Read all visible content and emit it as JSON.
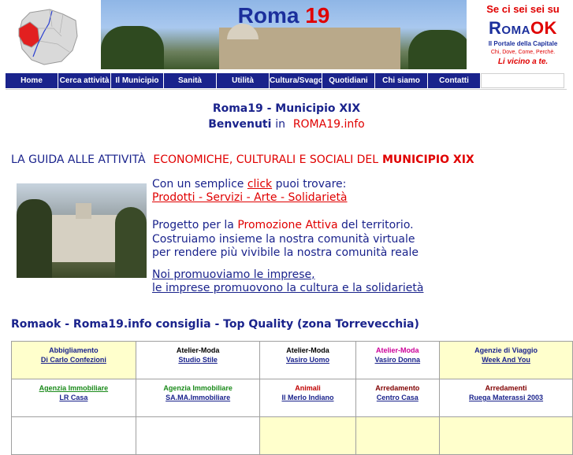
{
  "banner": {
    "title_main": "Roma",
    "title_num": "19"
  },
  "ad": {
    "line1": "Se ci sei sei su",
    "brand_roma": "Roma",
    "brand_ok": "OK",
    "line3": "Il Portale della Capitale",
    "line4": "Chi, Dove, Come, Perchè.",
    "line5": "Li vicino a te."
  },
  "nav": {
    "items": [
      "Home",
      "Cerca attività",
      "Il Municipio",
      "Sanità",
      "Utilità",
      "Cultura/Svago",
      "Quotidiani",
      "Chi siamo",
      "Contatti"
    ]
  },
  "intro": {
    "title": "Roma19 - Municipio XIX",
    "welcome": "Benvenuti",
    "in": "in",
    "site": "ROMA19.info"
  },
  "guide": {
    "part1": "LA GUIDA ALLE ATTIVITÀ",
    "part2": "ECONOMICHE, CULTURALI E SOCIALI DEL",
    "part3": "MUNICIPIO XIX"
  },
  "body": {
    "line1_a": "Con un semplice",
    "line1_link": "click",
    "line1_b": "puoi trovare:",
    "line2_link": "Prodotti - Servizi - Arte - Solidarietà",
    "line3_a": "Progetto per la",
    "line3_red": "Promozione Attiva",
    "line3_b": "del  territorio.",
    "line4": "Costruiamo insieme la nostra comunità virtuale",
    "line5": "per rendere più vivibile la nostra comunità reale",
    "line6_link": "Noi promuoviamo le imprese, ",
    "line7_link": "le imprese promuovono la cultura e la solidarietà"
  },
  "consiglia": {
    "title": "Romaok - Roma19.info consiglia - Top Quality (zona Torrevecchia)"
  },
  "grid": {
    "rows": [
      [
        {
          "cat": "Abbigliamento",
          "name": "Di Carlo Confezioni ",
          "cat_color": "dark",
          "bg": "yellow"
        },
        {
          "cat": "Atelier-Moda",
          "name": "Studio Stile",
          "cat_color": "black",
          "bg": "white"
        },
        {
          "cat": "Atelier-Moda",
          "name": "Vasiro Uomo",
          "cat_color": "black",
          "bg": "white"
        },
        {
          "cat": "Atelier-Moda",
          "name": "Vasiro Donna",
          "cat_color": "pink",
          "bg": "white"
        },
        {
          "cat": "Agenzie di Viaggio",
          "name": "Week And You ",
          "cat_color": "dark",
          "bg": "yellow"
        }
      ],
      [
        {
          "cat": "Agenzia Immobiliare",
          "name": "LR Casa",
          "cat_color": "green",
          "bg": "white"
        },
        {
          "cat": "Agenzia Immobiliare",
          "name": "SA.MA.Immobiliare",
          "cat_color": "green",
          "bg": "white"
        },
        {
          "cat": "Animali",
          "name": "Il Merlo Indiano",
          "cat_color": "red",
          "bg": "white"
        },
        {
          "cat": "Arredamento",
          "name": "Centro Casa",
          "cat_color": "red",
          "bg": "white"
        },
        {
          "cat": "Arredamenti",
          "name": "Ruega Materassi 2003",
          "cat_color": "maroon",
          "bg": "white"
        }
      ]
    ]
  }
}
